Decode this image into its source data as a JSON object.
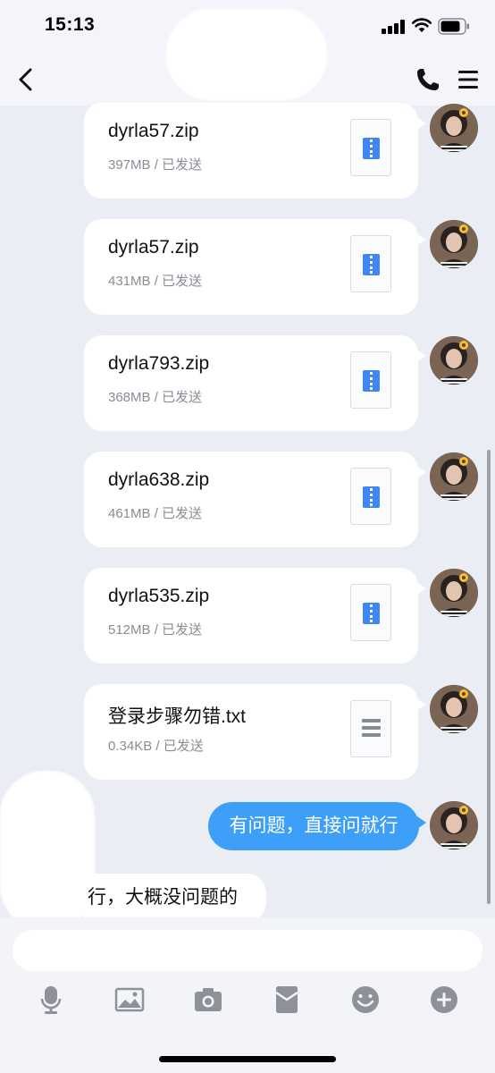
{
  "status_bar": {
    "time": "15:13"
  },
  "chat": {
    "files": [
      {
        "name": "dyrla57.zip",
        "meta": "397MB / 已发送",
        "type": "zip"
      },
      {
        "name": "dyrla57.zip",
        "meta": "431MB / 已发送",
        "type": "zip"
      },
      {
        "name": "dyrla793.zip",
        "meta": "368MB / 已发送",
        "type": "zip"
      },
      {
        "name": "dyrla638.zip",
        "meta": "461MB / 已发送",
        "type": "zip"
      },
      {
        "name": "dyrla535.zip",
        "meta": "512MB / 已发送",
        "type": "zip"
      },
      {
        "name": "登录步骤勿错.txt",
        "meta": "0.34KB / 已发送",
        "type": "txt"
      }
    ],
    "my_message": "有问题，直接问就行",
    "their_message": "行，大概没问题的"
  },
  "toolbar": {
    "icons": [
      "microphone-icon",
      "image-icon",
      "camera-icon",
      "red-packet-icon",
      "emoji-icon",
      "plus-icon"
    ]
  },
  "colors": {
    "accent": "#3e9ff8",
    "zip_icon": "#3f86f3",
    "background": "#ebedf5"
  }
}
